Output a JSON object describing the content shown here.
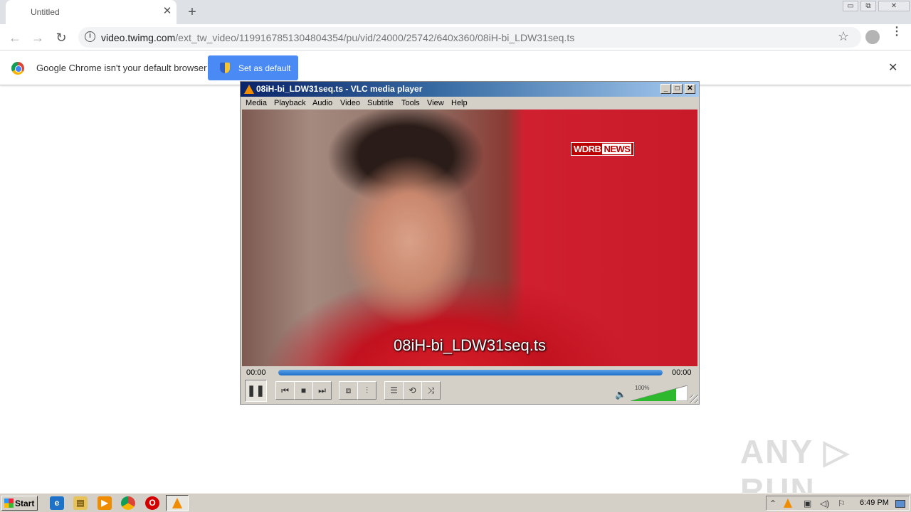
{
  "browser": {
    "tab_title": "Untitled",
    "tab_close": "✕",
    "new_tab": "+",
    "window_controls": {
      "minimize": "▭",
      "restore": "⧉",
      "close": "✕"
    },
    "nav": {
      "back": "←",
      "forward": "→",
      "reload": "↻"
    },
    "url_domain": "video.twimg.com",
    "url_path": "/ext_tw_video/1199167851304804354/pu/vid/24000/25742/640x360/08iH-bi_LDW31seq.ts",
    "star_icon": "☆",
    "menu_icon": "⋮"
  },
  "infobar": {
    "message": "Google Chrome isn't your default browser",
    "button_label": "Set as default",
    "close": "✕"
  },
  "vlc": {
    "title": "08iH-bi_LDW31seq.ts - VLC media player",
    "win_controls": {
      "minimize": "_",
      "maximize": "□",
      "close": "✕"
    },
    "menus": [
      "Media",
      "Playback",
      "Audio",
      "Video",
      "Subtitle",
      "Tools",
      "View",
      "Help"
    ],
    "video_logo": "WDRB",
    "video_logo_news": "NEWS",
    "subtitle": "08iH-bi_LDW31seq.ts",
    "time_elapsed": "00:00",
    "time_total": "00:00",
    "seek_fraction": 1.0,
    "controls": {
      "play_pause": "❚❚",
      "prev": "⏮",
      "stop": "■",
      "next": "⏭",
      "fullscreen": "⧈",
      "extended": "⫶",
      "playlist": "☰",
      "loop": "⟲",
      "random": "⤨",
      "volume_icon": "🔈"
    },
    "volume_label": "100%",
    "volume_fraction": 1.0
  },
  "watermark": "ANY ▷ RUN",
  "taskbar": {
    "start_label": "Start",
    "clock": "6:49 PM",
    "tray_up": "⌃",
    "tray_flag": "⚐"
  },
  "colors": {
    "chrome_blue": "#4a8af4",
    "vlc_title_start": "#0a246a",
    "seek_blue": "#1e6fc8",
    "volume_green": "#2db82d"
  }
}
